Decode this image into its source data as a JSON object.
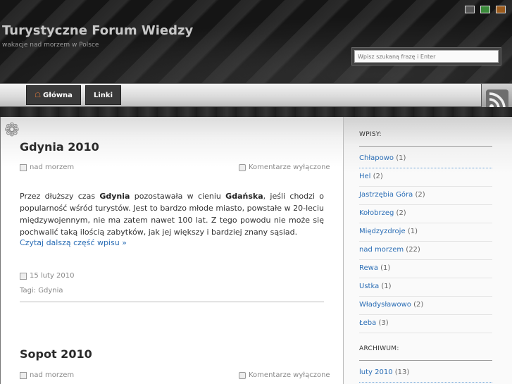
{
  "header": {
    "title": "Turystyczne Forum Wiedzy",
    "description": "wakacje nad morzem w Polsce",
    "swatch_colors": [
      "#555555",
      "#3a8a3a",
      "#9a5a1c"
    ],
    "search_placeholder": "Wpisz szukaną frazę i Enter"
  },
  "nav": {
    "home_label": "Główna",
    "links_label": "Linki"
  },
  "posts": [
    {
      "title": "Gdynia 2010",
      "category": "nad morzem",
      "comments": "Komentarze wyłączone",
      "excerpt_parts": [
        "Przez dłuższy czas ",
        "Gdynia",
        " pozostawała w cieniu ",
        "Gdańska",
        ", jeśli chodzi o popularność wśród turystów. Jest to bardzo młode miasto, powstałe w 20-leciu międzywojennym, nie ma zatem nawet 100 lat. Z tego powodu nie może się pochwalić taką ilością zabytków, jak jej większy i bardziej znany sąsiad."
      ],
      "read_more": "Czytaj dalszą część wpisu »",
      "date": "15 luty 2010",
      "tags": "Tagi: Gdynia"
    },
    {
      "title": "Sopot 2010",
      "category": "nad morzem",
      "comments": "Komentarze wyłączone"
    }
  ],
  "sidebar": {
    "posts_title": "WPISY:",
    "categories": [
      {
        "name": "Chłapowo",
        "count": "(1)"
      },
      {
        "name": "Hel",
        "count": "(2)"
      },
      {
        "name": "Jastrzębia Góra",
        "count": "(2)"
      },
      {
        "name": "Kołobrzeg",
        "count": "(2)"
      },
      {
        "name": "Międzyzdroje",
        "count": "(1)"
      },
      {
        "name": "nad morzem",
        "count": "(22)"
      },
      {
        "name": "Rewa",
        "count": "(1)"
      },
      {
        "name": "Ustka",
        "count": "(1)"
      },
      {
        "name": "Władysławowo",
        "count": "(2)"
      },
      {
        "name": "Łeba",
        "count": "(3)"
      }
    ],
    "archive_title": "ARCHIWUM:",
    "archive": [
      {
        "name": "luty 2010",
        "count": "(13)"
      }
    ]
  }
}
